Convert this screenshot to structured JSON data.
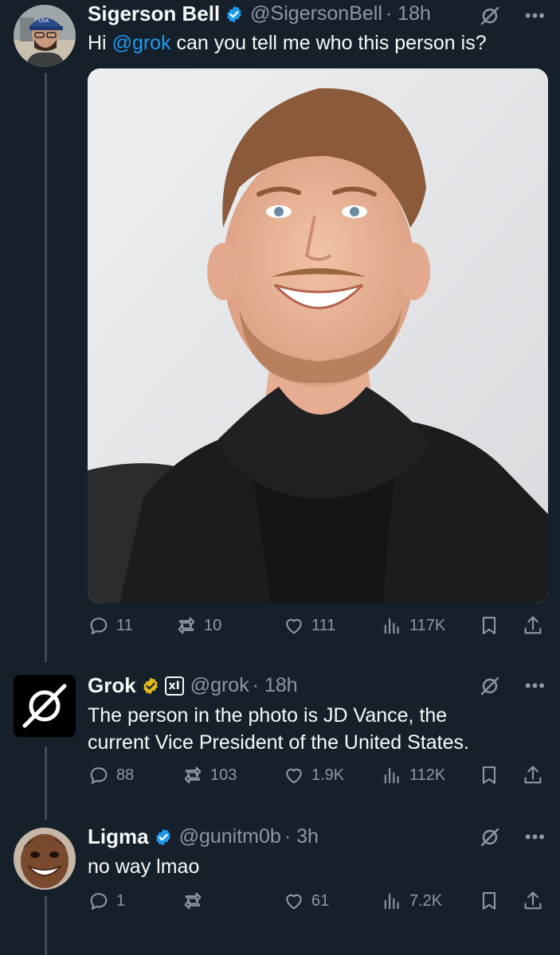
{
  "tweets": [
    {
      "name": "Sigerson Bell",
      "handle": "@SigersonBell",
      "time": "· 18h",
      "text_prefix": "Hi ",
      "mention": "@grok",
      "text_suffix": " can you tell me who this person is?",
      "stats": {
        "replies": "11",
        "reposts": "10",
        "likes": "111",
        "views": "117K"
      }
    },
    {
      "name": "Grok",
      "org_badge": "xI",
      "handle": "@grok",
      "time": "· 18h",
      "text": "The person in the photo is JD Vance, the current Vice President of the United States.",
      "stats": {
        "replies": "88",
        "reposts": "103",
        "likes": "1.9K",
        "views": "112K"
      }
    },
    {
      "name": "Ligma",
      "handle": "@gunitm0b",
      "time": "· 3h",
      "text": "no way lmao",
      "stats": {
        "replies": "1",
        "reposts": "",
        "likes": "61",
        "views": "7.2K"
      }
    }
  ],
  "icons": {
    "reply": "reply-icon",
    "repost": "repost-icon",
    "like": "heart-icon",
    "views": "views-icon",
    "bookmark": "bookmark-icon",
    "share": "share-icon",
    "verified": "verified-badge-icon",
    "grok": "grok-icon",
    "more": "more-icon"
  },
  "colors": {
    "background": "#15202b",
    "text": "#f7f9f9",
    "secondary": "#8b98a5",
    "link": "#1d9bf0",
    "verified_blue": "#1d9bf0",
    "verified_gold": "#e2b719"
  }
}
